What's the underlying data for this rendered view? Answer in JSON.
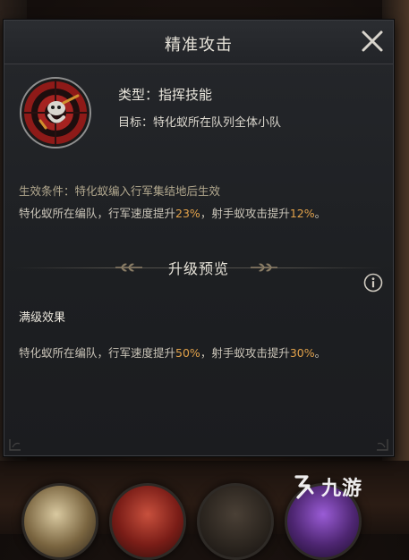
{
  "dialog": {
    "title": "精准攻击",
    "skill_icon": "crosshair-soldier-emblem-icon",
    "type_line": "类型：指挥技能",
    "target_line": "目标：特化蚁所在队列全体小队",
    "condition": "生效条件：特化蚁编入行军集结地后生效",
    "current_effect": {
      "text_a": "特化蚁所在编队，行军速度提升",
      "value_a": "23%",
      "text_b": "，射手蚁攻击提升",
      "value_b": "12%",
      "text_c": "。"
    },
    "upgrade_section": {
      "title": "升级预览",
      "max_level_label": "满级效果",
      "max_effect": {
        "text_a": "特化蚁所在编队，行军速度提升",
        "value_a": "50%",
        "text_b": "，射手蚁攻击提升",
        "value_b": "30%",
        "text_c": "。"
      }
    }
  },
  "watermark": {
    "text": "九游"
  },
  "colors": {
    "highlight": "#e2a24a",
    "panel_bg": "#1d1f22",
    "text_main": "#ece8de",
    "text_muted": "#b3a98f"
  }
}
